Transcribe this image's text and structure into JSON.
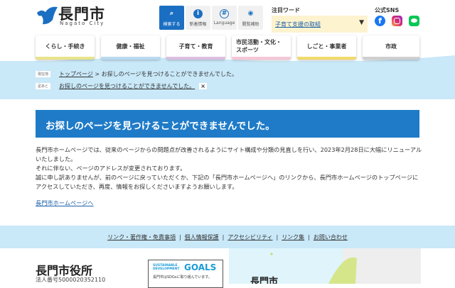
{
  "header": {
    "logo_title": "長門市",
    "logo_sub": "Nagato City",
    "tools": [
      {
        "label": "検索する",
        "icon": "search-icon"
      },
      {
        "label": "新着情報",
        "icon": "info-icon"
      },
      {
        "label": "Language",
        "icon": "globe-icon"
      },
      {
        "label": "閲覧補助",
        "icon": "eye-icon"
      }
    ],
    "featured_label": "注目ワード",
    "featured_value": "子育て支援の取組",
    "sns_label": "公式SNS",
    "sns": [
      "facebook-icon",
      "instagram-icon",
      "line-icon"
    ]
  },
  "nav": [
    {
      "label": "くらし・手続き",
      "color": "#e8e48a"
    },
    {
      "label": "健康・福祉",
      "color": "#b9daf0"
    },
    {
      "label": "子育て・教育",
      "color": "#dcbfe0"
    },
    {
      "label": "市民活動・文化・スポーツ",
      "color": "#f5c6d8"
    },
    {
      "label": "しごと・事業者",
      "color": "#f1da6a"
    },
    {
      "label": "市政",
      "color": "#cfcfcf"
    }
  ],
  "breadcrumb": {
    "current_tag": "現在地",
    "home": "トップページ",
    "sep": ">",
    "current": "お探しのページを見つけることができませんでした。",
    "history_tag": "足あと",
    "history_item": "お探しのページを見つけることができませんでした。",
    "close": "×"
  },
  "main": {
    "title": "お探しのページを見つけることができませんでした。",
    "paragraphs": [
      "長門市ホームページでは、従来のページからの問題点が改善されるようにサイト構成や分類の見直しを行い、2023年2月28日に大幅にリニューアルいたしました。",
      "それに伴ない、ページのアドレスが変更されております。",
      "誠に申し訳ありませんが、前のページに戻っていただくか、下記の「長門市ホームページへ」のリンクから、長門市ホームページのトップページにアクセスしていただき、再度、情報をお探しくださいますようお願いします。"
    ],
    "link": "長門市ホームページへ"
  },
  "footer": {
    "links": [
      "リンク・著作権・免責事項",
      "個人情報保護",
      "アクセシビリティ",
      "リンク集",
      "お問い合わせ"
    ],
    "sep": "|",
    "office": "長門市役所",
    "corp_no": "法人番号5000020352110",
    "sdgs_title1": "SUSTAINABLE DEVELOPMENT",
    "sdgs_title2": "GOALS",
    "sdgs_text": "長門市はSDGsに取り組んでいます。",
    "map_label": "長門市"
  }
}
